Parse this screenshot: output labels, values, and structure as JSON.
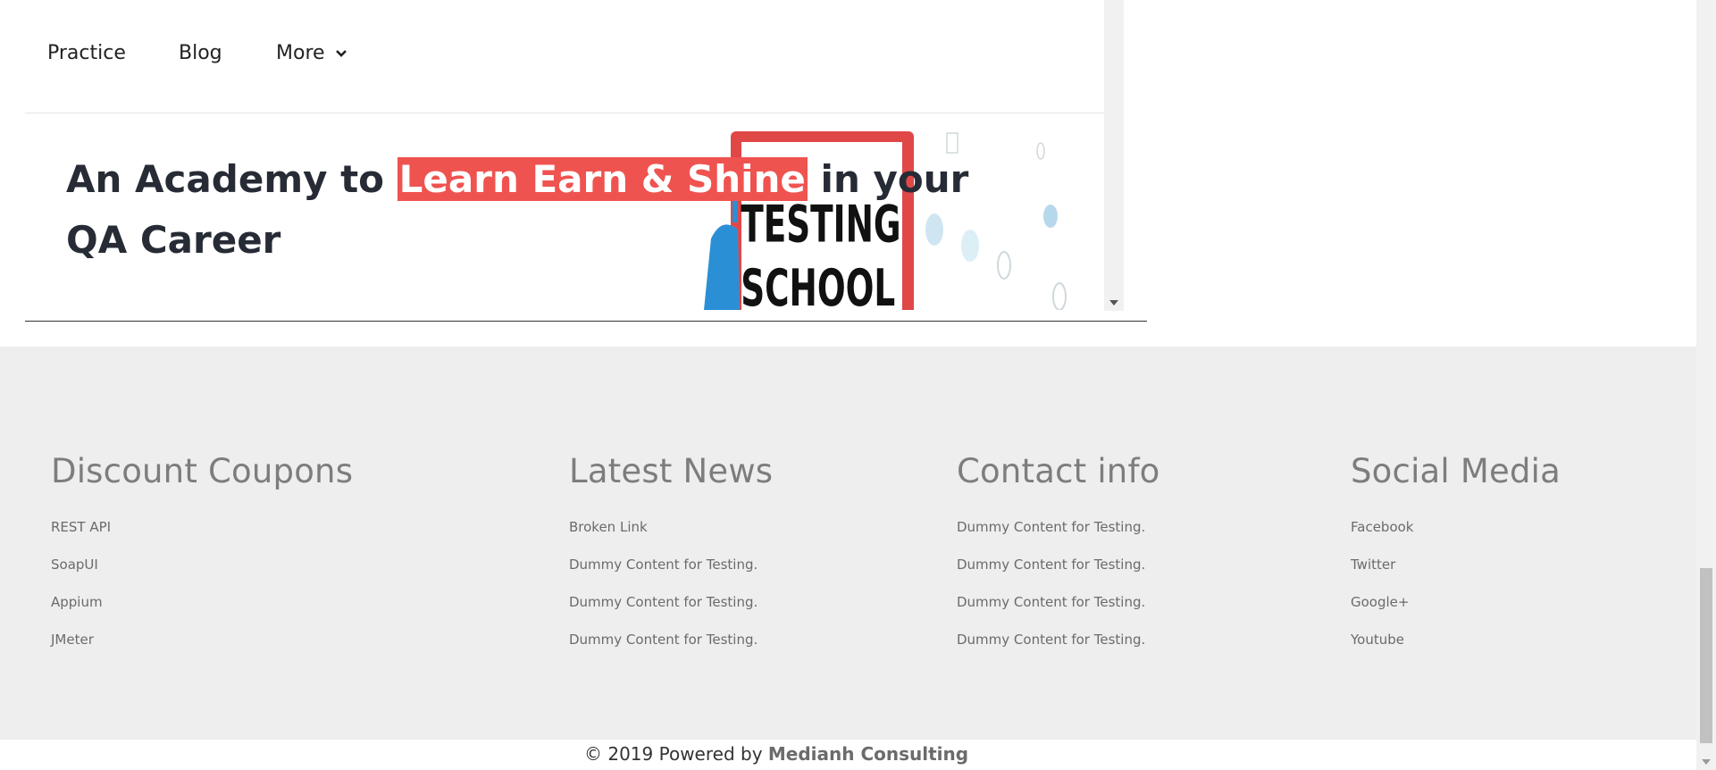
{
  "nav": {
    "items": [
      {
        "label": "Practice"
      },
      {
        "label": "Blog"
      },
      {
        "label": "More"
      }
    ]
  },
  "hero": {
    "title_before": "An Academy to ",
    "title_highlight": "Learn Earn & Shine",
    "title_after": "  in your QA Career",
    "illustration_text": "TESTING SCHOOL"
  },
  "footer": {
    "columns": [
      {
        "title": "Discount Coupons",
        "links": [
          "REST API",
          "SoapUI",
          "Appium",
          "JMeter"
        ]
      },
      {
        "title": "Latest News",
        "links": [
          "Broken Link",
          "Dummy Content for Testing.",
          "Dummy Content for Testing.",
          "Dummy Content for Testing."
        ]
      },
      {
        "title": "Contact info",
        "links": [
          "Dummy Content for Testing.",
          "Dummy Content for Testing.",
          "Dummy Content for Testing.",
          "Dummy Content for Testing."
        ]
      },
      {
        "title": "Social Media",
        "links": [
          "Facebook",
          "Twitter",
          "Google+",
          "Youtube"
        ]
      }
    ],
    "copyright_prefix": "© 2019 Powered by ",
    "copyright_link": "Medianh Consulting"
  },
  "colors": {
    "highlight": "#ef5350",
    "heading_dark": "#272b35",
    "footer_bg": "#eeeeee",
    "footer_heading": "#7d7d7d"
  }
}
